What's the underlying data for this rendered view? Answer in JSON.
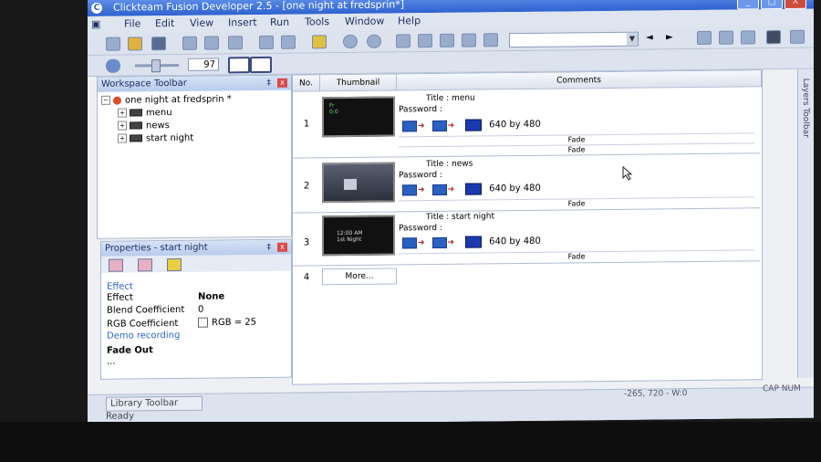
{
  "window": {
    "title": "Clickteam Fusion Developer 2.5 - [one night at fredsprin*]",
    "min_label": "_",
    "max_label": "□",
    "close_label": "X"
  },
  "menu": [
    "File",
    "Edit",
    "View",
    "Insert",
    "Run",
    "Tools",
    "Window",
    "Help"
  ],
  "toolbar2": {
    "zoom_value": "97"
  },
  "workspace": {
    "title": "Workspace Toolbar",
    "pin": "‡",
    "close": "x",
    "app": "one night at fredsprin *",
    "frames": [
      "menu",
      "news",
      "start night"
    ]
  },
  "properties": {
    "title": "Properties - start night",
    "pin": "‡",
    "close": "x",
    "rows": [
      {
        "key": "Effect",
        "value": "",
        "heading": true
      },
      {
        "key": "Effect",
        "value": "None"
      },
      {
        "key": "Blend Coefficient",
        "value": "0"
      },
      {
        "key": "RGB Coefficient",
        "value": "RGB = 25"
      },
      {
        "key": "Demo recording",
        "value": "",
        "heading": true
      }
    ],
    "footer_title": "Fade Out",
    "footer_sub": "..."
  },
  "frame_list": {
    "col_no": "No.",
    "col_thumb": "Thumbnail",
    "col_comments": "Comments",
    "rows": [
      {
        "no": "1",
        "title": "Title : menu",
        "password": "Password :",
        "resolution": "640  by  480",
        "fade_in": "Fade",
        "fade_out": "Fade",
        "thumb_text": "Fr\n0:0"
      },
      {
        "no": "2",
        "title": "Title : news",
        "password": "Password :",
        "resolution": "640  by  480",
        "fade_in": "",
        "fade_out": "Fade",
        "thumb_text": ""
      },
      {
        "no": "3",
        "title": "Title : start night",
        "password": "Password :",
        "resolution": "640  by  480",
        "fade_in": "",
        "fade_out": "Fade",
        "thumb_text": "12:00 AM\n1st Night"
      }
    ],
    "more_no": "4",
    "more_label": "More..."
  },
  "right_toolbar": {
    "label": "Layers Toolbar"
  },
  "status": {
    "library_tab": "Library Toolbar",
    "ready": "Ready",
    "coords": "-265, 720 - W:0",
    "capnum": "CAP NUM"
  }
}
